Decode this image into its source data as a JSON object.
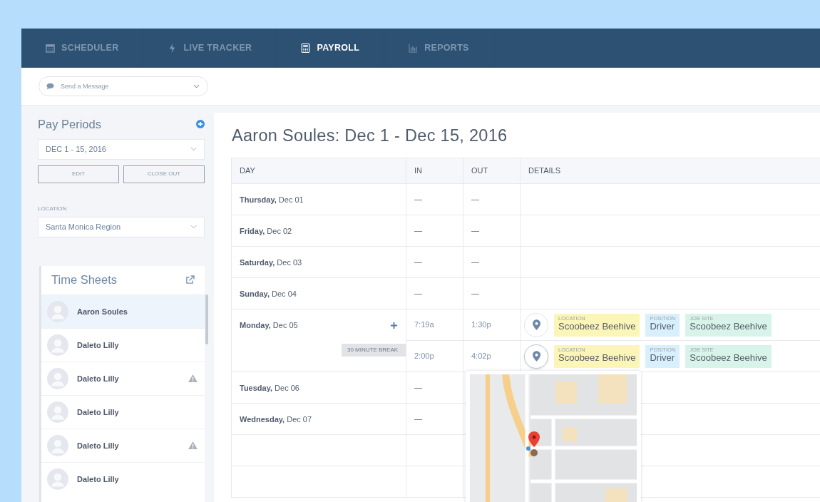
{
  "nav": {
    "tabs": [
      {
        "label": "SCHEDULER",
        "selected": false
      },
      {
        "label": "LIVE TRACKER",
        "selected": false
      },
      {
        "label": "PAYROLL",
        "selected": true
      },
      {
        "label": "REPORTS",
        "selected": false
      }
    ]
  },
  "message": {
    "placeholder": "Send a Message"
  },
  "sidebar": {
    "pay_periods": {
      "title": "Pay Periods",
      "value": "DEC 1 - 15, 2016",
      "buttons": [
        "EDIT",
        "CLOSE OUT"
      ]
    },
    "location": {
      "label": "LOCATION",
      "value": "Santa Monica Region"
    },
    "time_sheets": {
      "title": "Time Sheets",
      "items": [
        {
          "name": "Aaron Soules",
          "selected": true,
          "warning": false
        },
        {
          "name": "Daleto Lilly",
          "selected": false,
          "warning": false
        },
        {
          "name": "Daleto Lilly",
          "selected": false,
          "warning": true
        },
        {
          "name": "Daleto Lilly",
          "selected": false,
          "warning": false
        },
        {
          "name": "Daleto Lilly",
          "selected": false,
          "warning": true
        },
        {
          "name": "Daleto Lilly",
          "selected": false,
          "warning": false
        }
      ]
    }
  },
  "main": {
    "title": "Aaron Soules: Dec 1 - Dec 15, 2016",
    "table": {
      "columns": [
        "DAY",
        "IN",
        "OUT",
        "DETAILS"
      ],
      "days": [
        {
          "day": "**Thursday,** Dec 01",
          "in": "—",
          "out": "—"
        },
        {
          "day": "**Friday,** Dec 02",
          "in": "—",
          "out": "—"
        },
        {
          "day": "**Saturday,** Dec 03",
          "in": "—",
          "out": "—"
        },
        {
          "day": "**Sunday,** Dec 04",
          "in": "—",
          "out": "—"
        },
        {
          "day": "**Monday,** Dec 05",
          "break": "30 MINUTE BREAK",
          "shifts": [
            {
              "in": "7:19a",
              "out": "1:30p",
              "map_open": false,
              "tags": [
                {
                  "label": "LOCATION",
                  "value": "Scoobeez Beehive",
                  "color": "#fbf5b8"
                },
                {
                  "label": "POSITION",
                  "value": "Driver",
                  "color": "#d8effc"
                },
                {
                  "label": "JOB SITE",
                  "value": "Scoobeez Beehive",
                  "color": "#d8f4ea"
                }
              ]
            },
            {
              "in": "2:00p",
              "out": "4:02p",
              "map_open": true,
              "tags": [
                {
                  "label": "LOCATION",
                  "value": "Scoobeez Beehive",
                  "color": "#fbf5b8"
                },
                {
                  "label": "POSITION",
                  "value": "Driver",
                  "color": "#d8effc"
                },
                {
                  "label": "JOB SITE",
                  "value": "Scoobeez Beehive",
                  "color": "#d8f4ea"
                }
              ]
            }
          ]
        },
        {
          "day": "**Tuesday,** Dec 06",
          "in": "—"
        },
        {
          "day": "**Wednesday,** Dec 07",
          "in": "—"
        }
      ]
    }
  }
}
